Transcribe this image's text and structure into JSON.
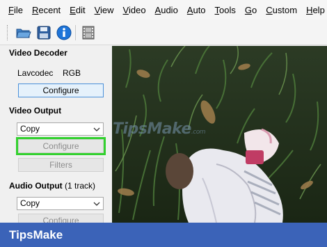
{
  "menu": [
    {
      "id": "file",
      "first": "F",
      "rest": "ile"
    },
    {
      "id": "recent",
      "first": "R",
      "rest": "ecent"
    },
    {
      "id": "edit",
      "first": "E",
      "rest": "dit"
    },
    {
      "id": "view",
      "first": "V",
      "rest": "iew"
    },
    {
      "id": "video",
      "first": "V",
      "rest": "ideo"
    },
    {
      "id": "audio",
      "first": "A",
      "rest": "udio"
    },
    {
      "id": "auto",
      "first": "A",
      "rest": "uto"
    },
    {
      "id": "tools",
      "first": "T",
      "rest": "ools"
    },
    {
      "id": "go",
      "first": "G",
      "rest": "o"
    },
    {
      "id": "custom",
      "first": "C",
      "rest": "ustom"
    },
    {
      "id": "help",
      "first": "H",
      "rest": "elp"
    }
  ],
  "toolbar": {
    "icons": [
      "open-folder-icon",
      "save-disk-icon",
      "info-icon",
      "film-strip-icon"
    ]
  },
  "video_decoder": {
    "title": "Video Decoder",
    "decoder_name": "Lavcodec",
    "color_space": "RGB",
    "configure_label": "Configure"
  },
  "video_output": {
    "title": "Video Output",
    "selected": "Copy",
    "configure_label": "Configure",
    "filters_label": "Filters"
  },
  "audio_output": {
    "title": "Audio Output",
    "track_info": "(1 track)",
    "selected": "Copy",
    "configure_label": "Configure"
  },
  "watermark": {
    "text": "TipsMake",
    "suffix": ".com"
  },
  "brand": {
    "text": "TipsMake"
  },
  "colors": {
    "highlight": "#33d12f",
    "brand_bar": "#3b63b8",
    "button_active_border": "#4a90d9"
  }
}
